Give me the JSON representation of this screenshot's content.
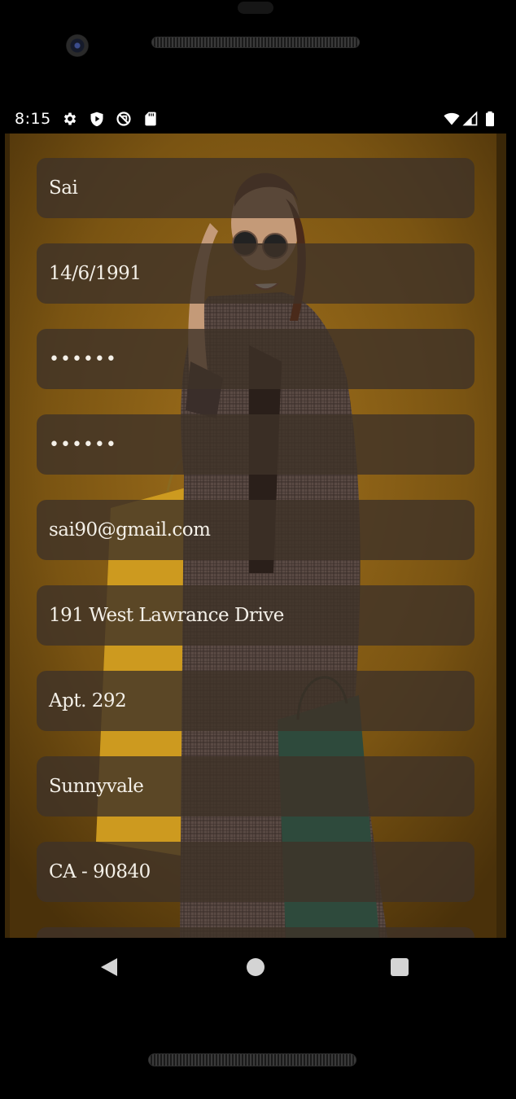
{
  "status_bar": {
    "time": "8:15",
    "icons_left": [
      "gear-icon",
      "play-protect-icon",
      "no-sync-icon",
      "sd-card-icon"
    ],
    "icons_right": [
      "wifi-icon",
      "signal-icon",
      "battery-icon"
    ]
  },
  "form": {
    "fields": [
      {
        "name": "name-field",
        "value": "Sai"
      },
      {
        "name": "dob-field",
        "value": "14/6/1991"
      },
      {
        "name": "password-field",
        "value": "••••••"
      },
      {
        "name": "confirm-password-field",
        "value": "••••••"
      },
      {
        "name": "email-field",
        "value": "sai90@gmail.com"
      },
      {
        "name": "address-line1-field",
        "value": "191 West Lawrance Drive"
      },
      {
        "name": "address-line2-field",
        "value": "Apt. 292"
      },
      {
        "name": "city-field",
        "value": "Sunnyvale"
      },
      {
        "name": "state-zip-field",
        "value": "CA - 90840"
      },
      {
        "name": "next-field",
        "value": ""
      }
    ]
  },
  "nav": {
    "buttons": [
      "back-icon",
      "home-icon",
      "recents-icon"
    ]
  },
  "colors": {
    "background": "#6a4a14",
    "field_fill": "#3e3228",
    "field_text": "#f4f0e8"
  }
}
